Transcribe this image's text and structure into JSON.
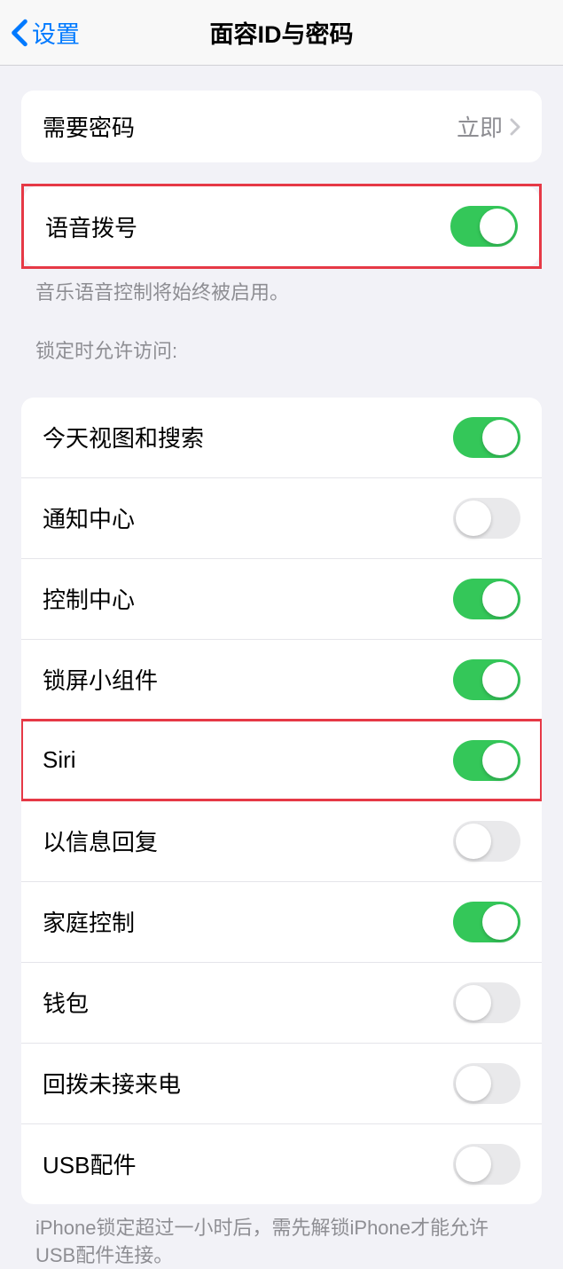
{
  "header": {
    "back_label": "设置",
    "title": "面容ID与密码"
  },
  "passcode": {
    "label": "需要密码",
    "value": "立即"
  },
  "voice_dial": {
    "label": "语音拨号",
    "footer": "音乐语音控制将始终被启用。",
    "on": true
  },
  "lock_section_header": "锁定时允许访问:",
  "lock_items": [
    {
      "label": "今天视图和搜索",
      "on": true
    },
    {
      "label": "通知中心",
      "on": false
    },
    {
      "label": "控制中心",
      "on": true
    },
    {
      "label": "锁屏小组件",
      "on": true
    },
    {
      "label": "Siri",
      "on": true
    },
    {
      "label": "以信息回复",
      "on": false
    },
    {
      "label": "家庭控制",
      "on": true
    },
    {
      "label": "钱包",
      "on": false
    },
    {
      "label": "回拨未接来电",
      "on": false
    },
    {
      "label": "USB配件",
      "on": false
    }
  ],
  "usb_footer": "iPhone锁定超过一小时后，需先解锁iPhone才能允许USB配件连接。"
}
